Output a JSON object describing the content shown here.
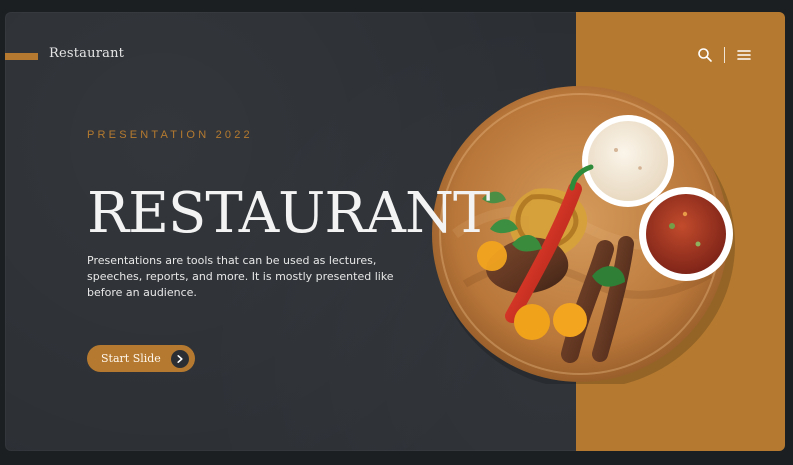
{
  "header": {
    "brand_name": "Restaurant"
  },
  "hero": {
    "eyebrow": "PRESENTATION 2022",
    "title": "RESTAURANT",
    "description": "Presentations are tools that can be used as lectures, speeches, reports, and more. It is mostly presented like before an audience.",
    "cta_label": "Start Slide"
  },
  "icons": {
    "search": "search-icon",
    "menu": "hamburger-menu-icon",
    "cta_arrow": "chevron-right-icon"
  },
  "colors": {
    "accent": "#b57a2f",
    "background": "#2b2f34",
    "text": "#f3f3f3"
  }
}
